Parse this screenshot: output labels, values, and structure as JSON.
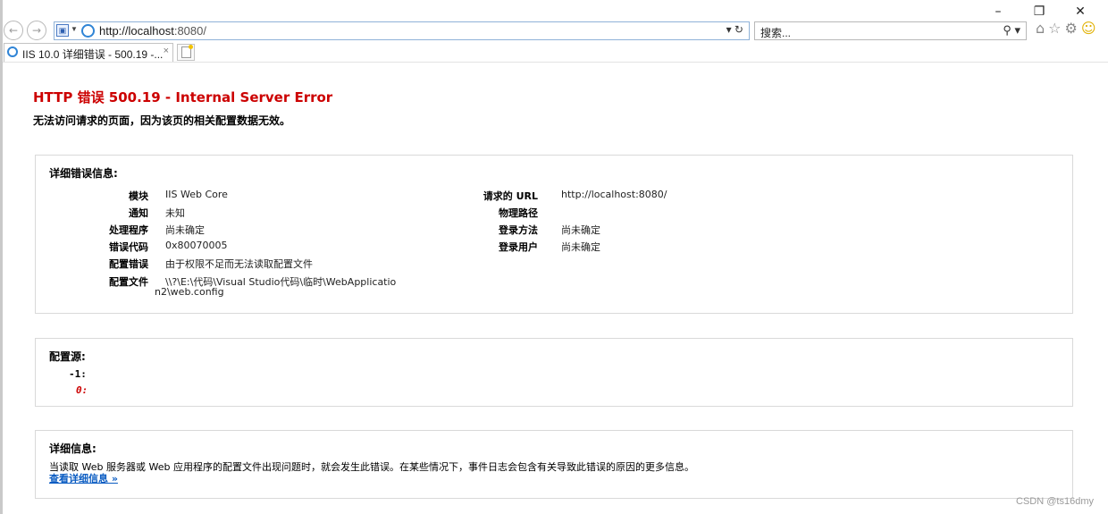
{
  "browser": {
    "window_controls": [
      "–",
      "❐",
      "✕"
    ],
    "url_host": "http://localhost",
    "url_port": ":8080/",
    "address_actions": "▾ ↻",
    "search_placeholder": "搜索...",
    "search_actions": "⚲ ▾",
    "tab_title": "IIS 10.0 详细错误 - 500.19 -...",
    "tab_close": "×",
    "icons": [
      "back-icon",
      "forward-icon",
      "compat-view-icon",
      "ie-logo-icon",
      "refresh-icon",
      "search-icon",
      "home-icon",
      "favorites-star-icon",
      "settings-gear-icon",
      "feedback-smiley-icon"
    ]
  },
  "error": {
    "title": "HTTP 错误 500.19 - Internal Server Error",
    "subtitle": "无法访问请求的页面，因为该页的相关配置数据无效。"
  },
  "details": {
    "heading": "详细错误信息:",
    "left": [
      {
        "label": "模块",
        "value": "IIS Web Core"
      },
      {
        "label": "通知",
        "value": "未知"
      },
      {
        "label": "处理程序",
        "value": "尚未确定"
      },
      {
        "label": "错误代码",
        "value": "0x80070005"
      },
      {
        "label": "配置错误",
        "value": "由于权限不足而无法读取配置文件"
      },
      {
        "label": "配置文件",
        "value_line1": "\\\\?\\E:\\代码\\Visual Studio代码\\临时\\WebApplicatio",
        "value_line2": "n2\\web.config"
      }
    ],
    "right": [
      {
        "label": "请求的 URL",
        "value": "http://localhost:8080/"
      },
      {
        "label": "物理路径",
        "value": ""
      },
      {
        "label": "登录方法",
        "value": "尚未确定"
      },
      {
        "label": "登录用户",
        "value": "尚未确定"
      }
    ]
  },
  "config_source": {
    "heading": "配置源:",
    "line_neg": "-1:",
    "line_zero": "0:"
  },
  "more_info": {
    "heading": "详细信息:",
    "text": "当读取 Web 服务器或 Web 应用程序的配置文件出现问题时，就会发生此错误。在某些情况下，事件日志会包含有关导致此错误的原因的更多信息。",
    "link": "查看详细信息 »"
  },
  "watermark": "CSDN @ts16dmy"
}
